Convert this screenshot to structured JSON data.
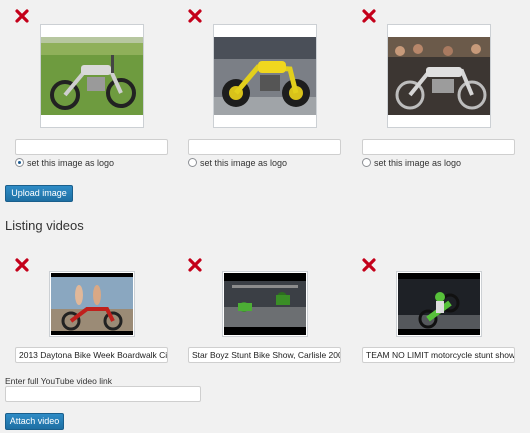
{
  "images": {
    "items": [
      {
        "caption": "",
        "logo_label": "set this image as logo",
        "logo_selected": true,
        "photo": "silver-cafe-racer-motorcycle-on-grass"
      },
      {
        "caption": "",
        "logo_label": "set this image as logo",
        "logo_selected": false,
        "photo": "yellow-motorcycle-at-show"
      },
      {
        "caption": "",
        "logo_label": "set this image as logo",
        "logo_selected": false,
        "photo": "chopper-motorcycle-at-indoor-show"
      }
    ],
    "upload_label": "Upload image",
    "delete_icon": "red-x-delete-icon"
  },
  "videos": {
    "heading": "Listing videos",
    "items": [
      {
        "title": "2013 Daytona Bike Week Boardwalk Ci",
        "thumb": "red-chopper-with-two-women"
      },
      {
        "title": "Star Boyz Stunt Bike Show, Carlisle 200",
        "thumb": "stunt-riders-in-arena"
      },
      {
        "title": "TEAM NO LIMIT motorcycle stunt show.",
        "thumb": "green-stunt-bike-wheelie"
      }
    ],
    "youtube_label": "Enter full YouTube video link",
    "youtube_value": "",
    "attach_label": "Attach video"
  },
  "colors": {
    "accent": "#2271b1",
    "delete": "#c4001a"
  }
}
